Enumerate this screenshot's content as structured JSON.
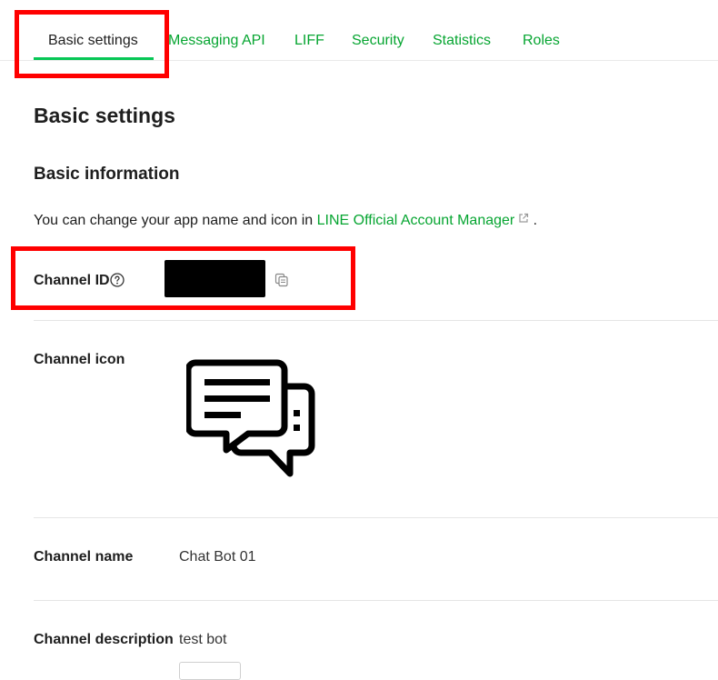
{
  "tabs": [
    {
      "label": "Basic settings",
      "active": true
    },
    {
      "label": "Messaging API",
      "active": false
    },
    {
      "label": "LIFF",
      "active": false
    },
    {
      "label": "Security",
      "active": false
    },
    {
      "label": "Statistics",
      "active": false
    },
    {
      "label": "Roles",
      "active": false
    }
  ],
  "page": {
    "title": "Basic settings"
  },
  "basic_info": {
    "title": "Basic information",
    "info_prefix": "You can change your app name and icon in ",
    "info_link": "LINE Official Account Manager",
    "info_suffix": " ."
  },
  "fields": {
    "channel_id": {
      "label": "Channel ID",
      "value_redacted": true
    },
    "channel_icon": {
      "label": "Channel icon",
      "icon": "chat-bubbles-icon"
    },
    "channel_name": {
      "label": "Channel name",
      "value": "Chat Bot 01"
    },
    "channel_description": {
      "label": "Channel description",
      "value": "test bot"
    }
  },
  "colors": {
    "accent_green": "#06a531",
    "underline_green": "#06c755",
    "highlight_red": "#ff0000",
    "text_dark": "#1e1e1e"
  },
  "icons": [
    "help-circle-icon",
    "external-link-icon",
    "copy-icon",
    "chat-bubbles-icon"
  ]
}
